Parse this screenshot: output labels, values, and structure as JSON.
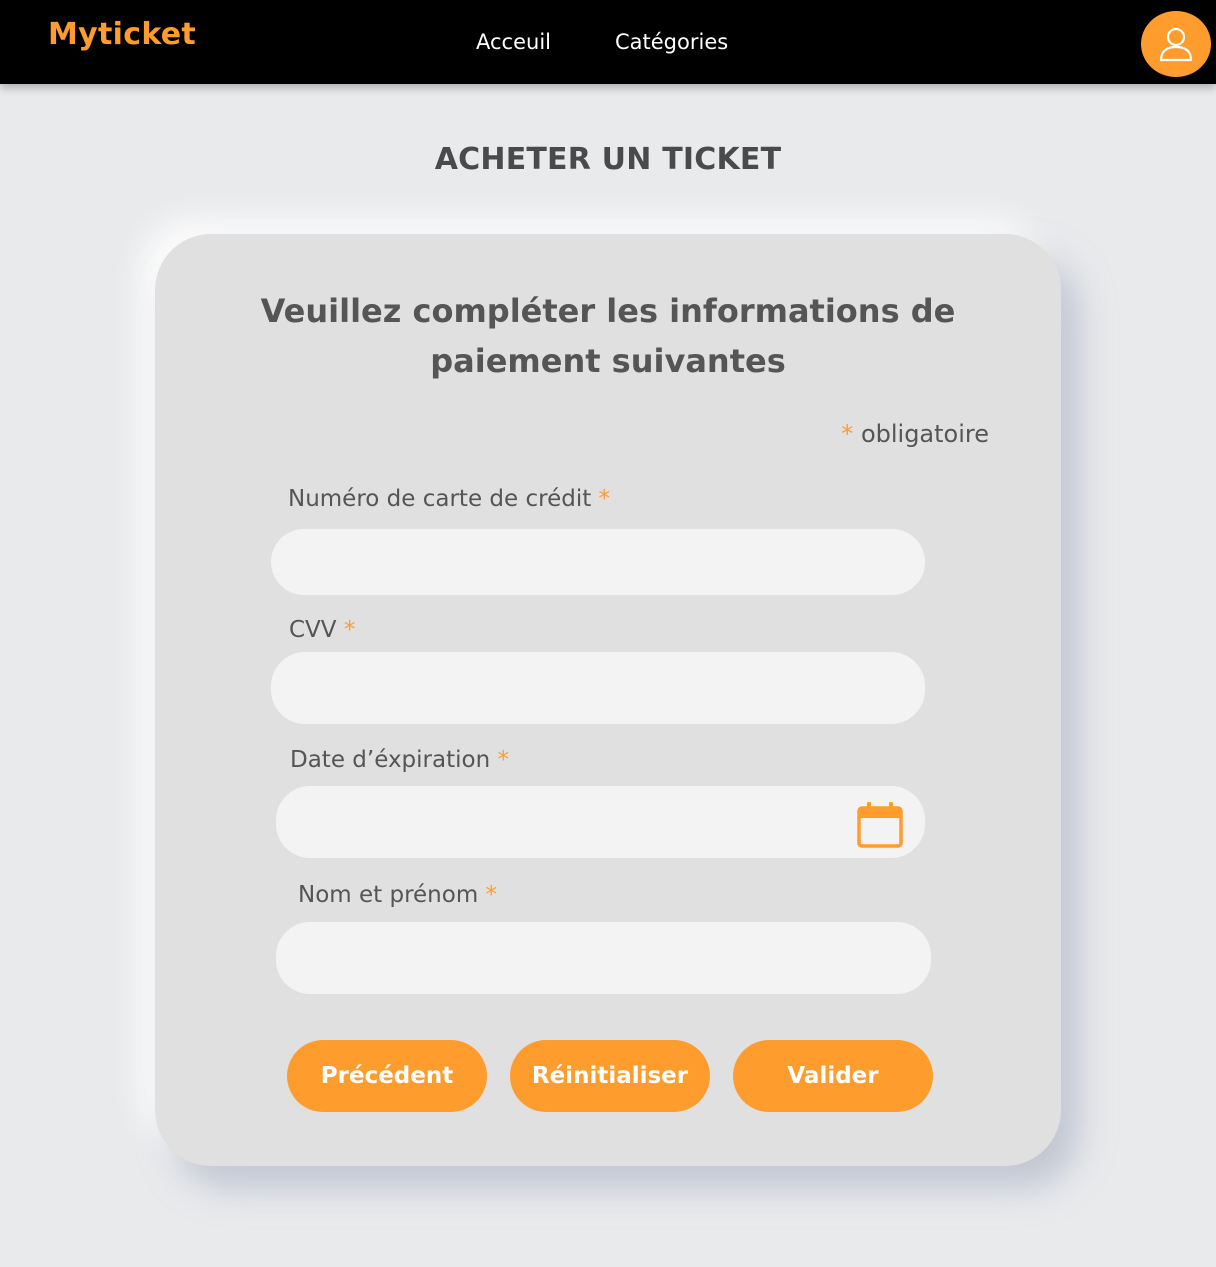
{
  "navbar": {
    "brand": "Myticket",
    "links": [
      "Acceuil",
      "Catégories"
    ]
  },
  "page": {
    "title": "ACHETER UN TICKET"
  },
  "form": {
    "heading_line1": "Veuillez compléter les informations de",
    "heading_line2": "paiement suivantes",
    "required_marker": "*",
    "required_note": "obligatoire",
    "fields": [
      {
        "label": "Numéro de carte de crédit",
        "value": "",
        "placeholder": ""
      },
      {
        "label": "CVV",
        "value": "",
        "placeholder": ""
      },
      {
        "label": "Date d’éxpiration",
        "value": "",
        "placeholder": ""
      },
      {
        "label": "Nom et prénom",
        "value": "",
        "placeholder": ""
      }
    ],
    "buttons": {
      "previous": "Précédent",
      "reset": "Réinitialiser",
      "submit": "Valider"
    }
  },
  "icons": {
    "avatar": "user-icon",
    "date_picker": "calendar-icon"
  },
  "colors": {
    "accent": "#ff9c2e",
    "navbar_bg": "#000000",
    "page_bg": "#e9eaec",
    "card_bg": "#e0e0e0",
    "input_bg": "#f3f3f3",
    "text": "#555555"
  }
}
